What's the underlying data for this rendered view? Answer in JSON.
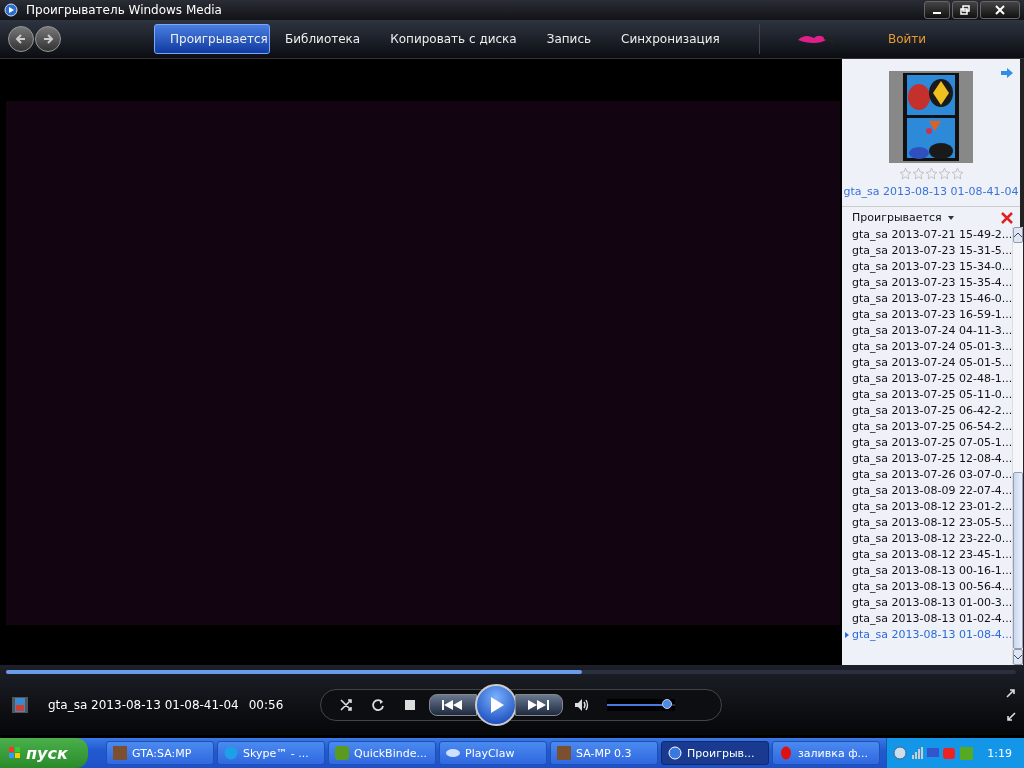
{
  "window": {
    "title": "Проигрыватель Windows Media"
  },
  "nav_tabs": [
    {
      "label": "Проигрывается",
      "selected": true
    },
    {
      "label": "Библиотека",
      "selected": false
    },
    {
      "label": "Копировать с диска",
      "selected": false
    },
    {
      "label": "Запись",
      "selected": false
    },
    {
      "label": "Синхронизация",
      "selected": false
    }
  ],
  "sign_in": "Войти",
  "now_playing": {
    "stars": 0,
    "title": "gta_sa 2013-08-13 01-08-41-04"
  },
  "playlist": {
    "header": "Проигрывается",
    "items": [
      {
        "label": "gta_sa 2013-07-21 15-49-2...",
        "selected": false
      },
      {
        "label": "gta_sa 2013-07-23 15-31-5...",
        "selected": false
      },
      {
        "label": "gta_sa 2013-07-23 15-34-0...",
        "selected": false
      },
      {
        "label": "gta_sa 2013-07-23 15-35-4...",
        "selected": false
      },
      {
        "label": "gta_sa 2013-07-23 15-46-0...",
        "selected": false
      },
      {
        "label": "gta_sa 2013-07-23 16-59-1...",
        "selected": false
      },
      {
        "label": "gta_sa 2013-07-24 04-11-3...",
        "selected": false
      },
      {
        "label": "gta_sa 2013-07-24 05-01-3...",
        "selected": false
      },
      {
        "label": "gta_sa 2013-07-24 05-01-5...",
        "selected": false
      },
      {
        "label": "gta_sa 2013-07-25 02-48-1...",
        "selected": false
      },
      {
        "label": "gta_sa 2013-07-25 05-11-0...",
        "selected": false
      },
      {
        "label": "gta_sa 2013-07-25 06-42-2...",
        "selected": false
      },
      {
        "label": "gta_sa 2013-07-25 06-54-2...",
        "selected": false
      },
      {
        "label": "gta_sa 2013-07-25 07-05-1...",
        "selected": false
      },
      {
        "label": "gta_sa 2013-07-25 12-08-4...",
        "selected": false
      },
      {
        "label": "gta_sa 2013-07-26 03-07-0...",
        "selected": false
      },
      {
        "label": "gta_sa 2013-08-09 22-07-4...",
        "selected": false
      },
      {
        "label": "gta_sa 2013-08-12 23-01-2...",
        "selected": false
      },
      {
        "label": "gta_sa 2013-08-12 23-05-5...",
        "selected": false
      },
      {
        "label": "gta_sa 2013-08-12 23-22-0...",
        "selected": false
      },
      {
        "label": "gta_sa 2013-08-12 23-45-1...",
        "selected": false
      },
      {
        "label": "gta_sa 2013-08-13 00-16-1...",
        "selected": false
      },
      {
        "label": "gta_sa 2013-08-13 00-56-4...",
        "selected": false
      },
      {
        "label": "gta_sa 2013-08-13 01-00-3...",
        "selected": false
      },
      {
        "label": "gta_sa 2013-08-13 01-02-4...",
        "selected": false
      },
      {
        "label": "gta_sa 2013-08-13 01-08-4...",
        "selected": true
      }
    ]
  },
  "seek": {
    "level": 0.57
  },
  "status": {
    "title": "gta_sa 2013-08-13 01-08-41-04",
    "time": "00:56"
  },
  "volume": {
    "level": 0.88
  },
  "taskbar": {
    "start": "пуск",
    "items": [
      {
        "label": "GTA:SA:MP",
        "selected": false
      },
      {
        "label": "Skype™ - ...",
        "selected": false
      },
      {
        "label": "QuickBinde...",
        "selected": false
      },
      {
        "label": "PlayClaw",
        "selected": false
      },
      {
        "label": "SA-MP 0.3",
        "selected": false
      },
      {
        "label": "Проигрыв...",
        "selected": true
      },
      {
        "label": "заливка ф...",
        "selected": false
      }
    ],
    "clock": "1:19"
  }
}
